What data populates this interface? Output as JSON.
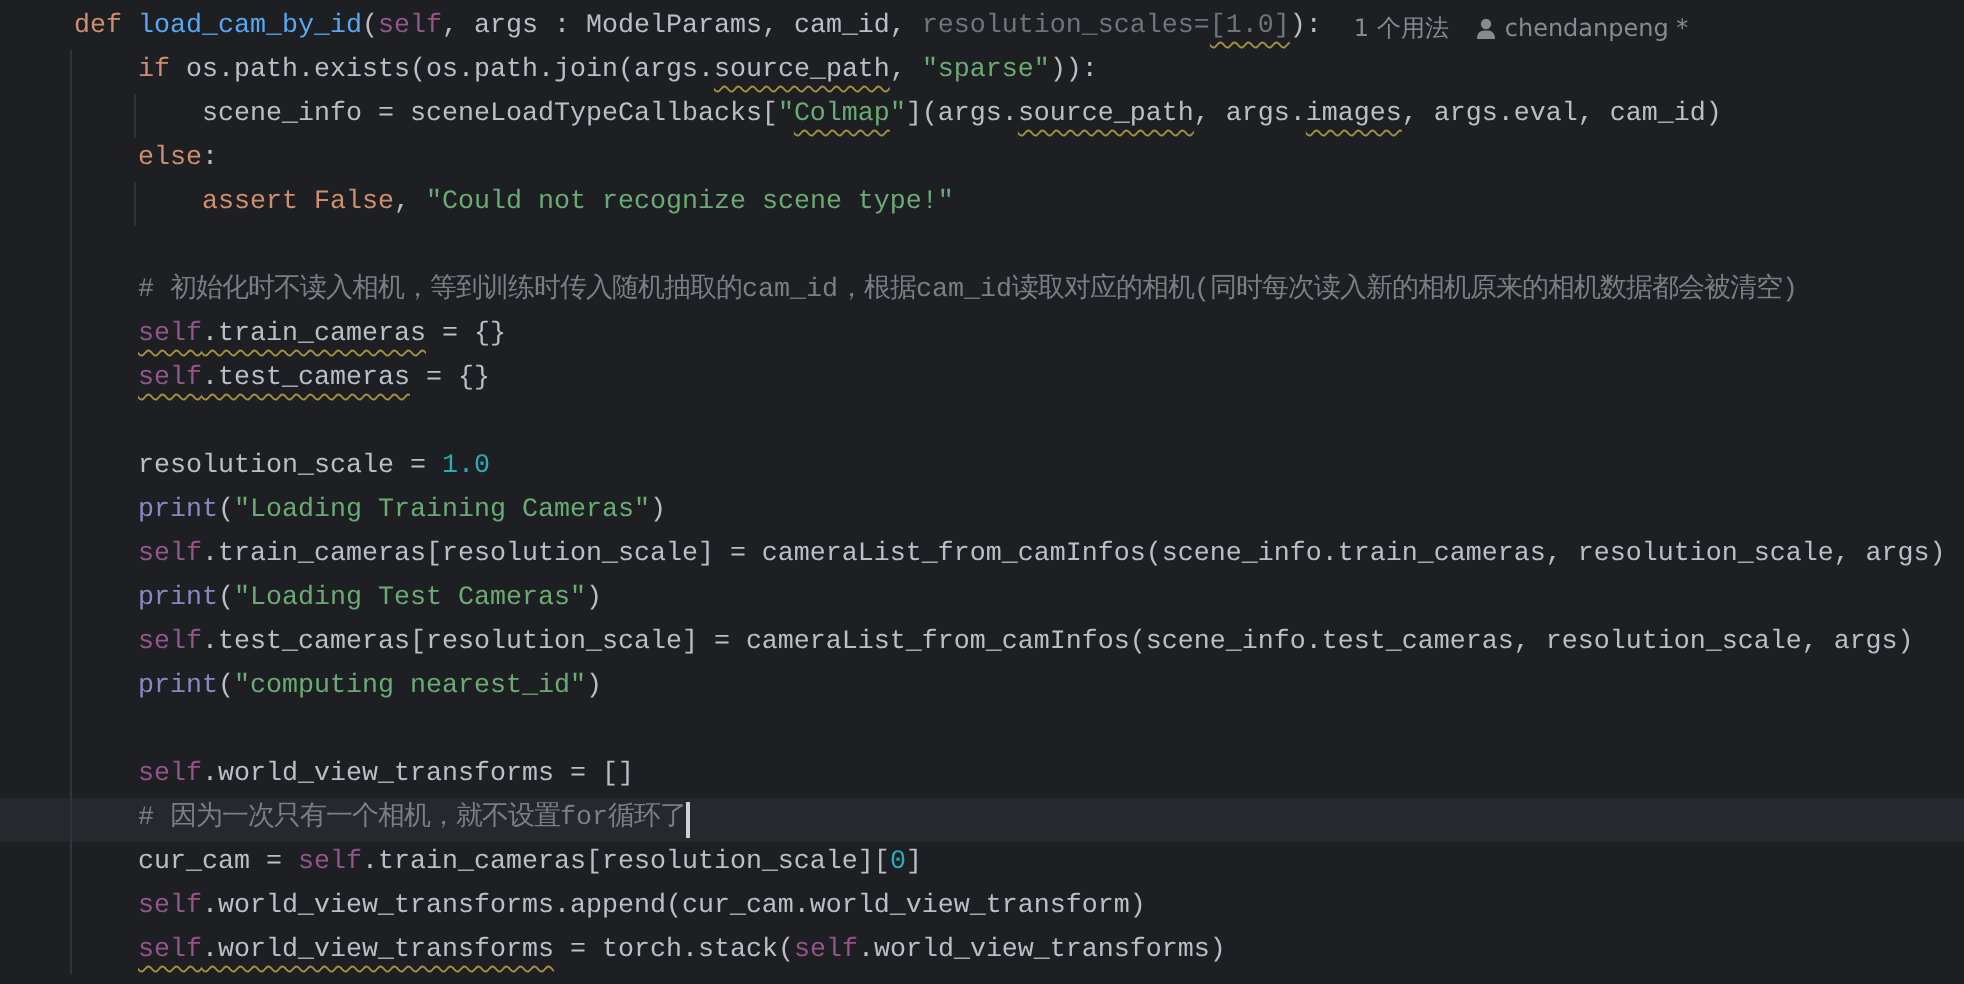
{
  "editor": {
    "lines": [
      {
        "kind": "code",
        "current": false,
        "code": [
          {
            "text": "def ",
            "kind": "keyword",
            "warning": false
          },
          {
            "text": "load_cam_by_id",
            "kind": "function",
            "warning": false
          },
          {
            "text": "(",
            "kind": "plain",
            "warning": false
          },
          {
            "text": "self",
            "kind": "self",
            "warning": false
          },
          {
            "text": ", args : ModelParams, cam_id, ",
            "kind": "plain",
            "warning": false
          },
          {
            "text": "resolution_scales=",
            "kind": "unused",
            "warning": false
          },
          {
            "text": "[1.0]",
            "kind": "unused",
            "warning": true
          },
          {
            "text": "):",
            "kind": "plain",
            "warning": false
          }
        ],
        "hints": [
          {
            "kind": "usages",
            "text": "1 个用法"
          },
          {
            "kind": "author",
            "text": "chendanpeng *"
          }
        ],
        "children": [
          {
            "kind": "code",
            "current": false,
            "code": [
              {
                "text": "if ",
                "kind": "keyword",
                "warning": false
              },
              {
                "text": "os.path.exists(os.path.join(args.",
                "kind": "plain",
                "warning": false
              },
              {
                "text": "source_path",
                "kind": "plain",
                "warning": true
              },
              {
                "text": ", ",
                "kind": "plain",
                "warning": false
              },
              {
                "text": "\"sparse\"",
                "kind": "string",
                "warning": false
              },
              {
                "text": ")):",
                "kind": "plain",
                "warning": false
              }
            ],
            "children": [
              {
                "kind": "code",
                "current": false,
                "code": [
                  {
                    "text": "scene_info = sceneLoadTypeCallbacks[",
                    "kind": "plain",
                    "warning": false
                  },
                  {
                    "text": "\"",
                    "kind": "string",
                    "warning": false
                  },
                  {
                    "text": "Colmap",
                    "kind": "string",
                    "warning": true
                  },
                  {
                    "text": "\"",
                    "kind": "string",
                    "warning": false
                  },
                  {
                    "text": "](args.",
                    "kind": "plain",
                    "warning": false
                  },
                  {
                    "text": "source_path",
                    "kind": "plain",
                    "warning": true
                  },
                  {
                    "text": ", args.",
                    "kind": "plain",
                    "warning": false
                  },
                  {
                    "text": "images",
                    "kind": "plain",
                    "warning": true
                  },
                  {
                    "text": ", args.eval, cam_id)",
                    "kind": "plain",
                    "warning": false
                  }
                ]
              }
            ]
          },
          {
            "kind": "code",
            "current": false,
            "code": [
              {
                "text": "else",
                "kind": "keyword",
                "warning": false
              },
              {
                "text": ":",
                "kind": "plain",
                "warning": false
              }
            ],
            "children": [
              {
                "kind": "code",
                "current": false,
                "code": [
                  {
                    "text": "assert False",
                    "kind": "keyword",
                    "warning": false
                  },
                  {
                    "text": ", ",
                    "kind": "plain",
                    "warning": false
                  },
                  {
                    "text": "\"Could not recognize scene type!\"",
                    "kind": "string",
                    "warning": false
                  }
                ]
              }
            ]
          },
          {
            "kind": "blank"
          },
          {
            "kind": "code",
            "current": false,
            "code": [
              {
                "text": "# 初始化时不读入相机，等到训练时传入随机抽取的cam_id，根据cam_id读取对应的相机(同时每次读入新的相机原来的相机数据都会被清空)",
                "kind": "comment",
                "warning": false
              }
            ]
          },
          {
            "kind": "code",
            "current": false,
            "code": [
              {
                "text": "self",
                "kind": "self",
                "warning": true
              },
              {
                "text": ".train_cameras",
                "kind": "plain",
                "warning": true
              },
              {
                "text": " = {}",
                "kind": "plain",
                "warning": false
              }
            ]
          },
          {
            "kind": "code",
            "current": false,
            "code": [
              {
                "text": "self",
                "kind": "self",
                "warning": true
              },
              {
                "text": ".test_cameras",
                "kind": "plain",
                "warning": true
              },
              {
                "text": " = {}",
                "kind": "plain",
                "warning": false
              }
            ]
          },
          {
            "kind": "blank"
          },
          {
            "kind": "code",
            "current": false,
            "code": [
              {
                "text": "resolution_scale = ",
                "kind": "plain",
                "warning": false
              },
              {
                "text": "1.0",
                "kind": "number",
                "warning": false
              }
            ]
          },
          {
            "kind": "code",
            "current": false,
            "code": [
              {
                "text": "print",
                "kind": "builtin",
                "warning": false
              },
              {
                "text": "(",
                "kind": "plain",
                "warning": false
              },
              {
                "text": "\"Loading Training Cameras\"",
                "kind": "string",
                "warning": false
              },
              {
                "text": ")",
                "kind": "plain",
                "warning": false
              }
            ]
          },
          {
            "kind": "code",
            "current": false,
            "code": [
              {
                "text": "self",
                "kind": "self",
                "warning": false
              },
              {
                "text": ".train_cameras[resolution_scale] = cameraList_from_camInfos(scene_info.train_cameras, resolution_scale, args)",
                "kind": "plain",
                "warning": false
              }
            ]
          },
          {
            "kind": "code",
            "current": false,
            "code": [
              {
                "text": "print",
                "kind": "builtin",
                "warning": false
              },
              {
                "text": "(",
                "kind": "plain",
                "warning": false
              },
              {
                "text": "\"Loading Test Cameras\"",
                "kind": "string",
                "warning": false
              },
              {
                "text": ")",
                "kind": "plain",
                "warning": false
              }
            ]
          },
          {
            "kind": "code",
            "current": false,
            "code": [
              {
                "text": "self",
                "kind": "self",
                "warning": false
              },
              {
                "text": ".test_cameras[resolution_scale] = cameraList_from_camInfos(scene_info.test_cameras, resolution_scale, args)",
                "kind": "plain",
                "warning": false
              }
            ]
          },
          {
            "kind": "code",
            "current": false,
            "code": [
              {
                "text": "print",
                "kind": "builtin",
                "warning": false
              },
              {
                "text": "(",
                "kind": "plain",
                "warning": false
              },
              {
                "text": "\"computing nearest_id\"",
                "kind": "string",
                "warning": false
              },
              {
                "text": ")",
                "kind": "plain",
                "warning": false
              }
            ]
          },
          {
            "kind": "blank"
          },
          {
            "kind": "code",
            "current": false,
            "code": [
              {
                "text": "self",
                "kind": "self",
                "warning": false
              },
              {
                "text": ".world_view_transforms = []",
                "kind": "plain",
                "warning": false
              }
            ]
          },
          {
            "kind": "code",
            "current": true,
            "code": [
              {
                "text": "# 因为一次只有一个相机，就不设置for循环了",
                "kind": "comment",
                "warning": false
              }
            ]
          },
          {
            "kind": "code",
            "current": false,
            "code": [
              {
                "text": "cur_cam = ",
                "kind": "plain",
                "warning": false
              },
              {
                "text": "self",
                "kind": "self",
                "warning": false
              },
              {
                "text": ".train_cameras[resolution_scale][",
                "kind": "plain",
                "warning": false
              },
              {
                "text": "0",
                "kind": "number",
                "warning": false
              },
              {
                "text": "]",
                "kind": "plain",
                "warning": false
              }
            ]
          },
          {
            "kind": "code",
            "current": false,
            "code": [
              {
                "text": "self",
                "kind": "self",
                "warning": false
              },
              {
                "text": ".world_view_transforms.append(cur_cam.world_view_transform)",
                "kind": "plain",
                "warning": false
              }
            ]
          },
          {
            "kind": "code",
            "current": false,
            "code": [
              {
                "text": "self",
                "kind": "self",
                "warning": true
              },
              {
                "text": ".world_view_transforms",
                "kind": "plain",
                "warning": true
              },
              {
                "text": " = torch.stack(",
                "kind": "plain",
                "warning": false
              },
              {
                "text": "self",
                "kind": "self",
                "warning": false
              },
              {
                "text": ".world_view_transforms)",
                "kind": "plain",
                "warning": false
              }
            ]
          }
        ]
      }
    ]
  }
}
